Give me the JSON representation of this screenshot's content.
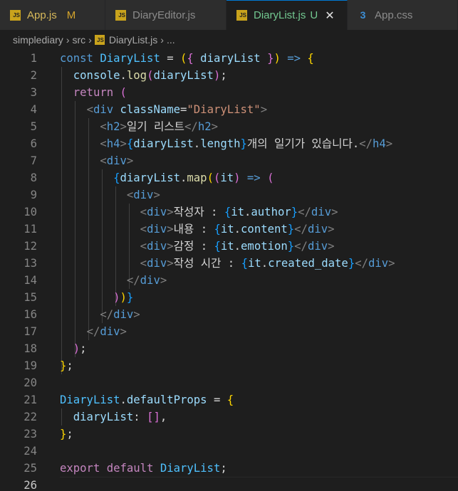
{
  "tabs": [
    {
      "name": "tab-app-js",
      "label": "App.js",
      "badge": "M",
      "icon": "js-icon",
      "width": 148
    },
    {
      "name": "tab-diaryeditor-js",
      "label": "DiaryEditor.js",
      "badge": "",
      "icon": "js-icon",
      "width": 170
    },
    {
      "name": "tab-diarylist-js",
      "label": "DiaryList.js",
      "badge": "U",
      "icon": "js-icon",
      "width": 170,
      "active": true,
      "close": "✕"
    },
    {
      "name": "tab-app-css",
      "label": "App.css",
      "badge": "",
      "icon": "css-icon",
      "width": 155
    }
  ],
  "breadcrumb": [
    "simplediary",
    "src",
    "DiaryList.js",
    "..."
  ],
  "editor": {
    "current_line": 26,
    "lines": [
      [
        [
          "t-kw",
          "const "
        ],
        [
          "t-var",
          "DiaryList"
        ],
        [
          "t-p",
          " = "
        ],
        [
          "b1",
          "("
        ],
        [
          "b2",
          "{"
        ],
        [
          "t-id",
          " diaryList "
        ],
        [
          "b2",
          "}"
        ],
        [
          "b1",
          ")"
        ],
        [
          "t-kw",
          " =>"
        ],
        [
          "t-p",
          " "
        ],
        [
          "b1",
          "{"
        ]
      ],
      [
        [
          "t-p",
          "  "
        ],
        [
          "t-id",
          "console"
        ],
        [
          "t-p",
          "."
        ],
        [
          "t-fn",
          "log"
        ],
        [
          "b2",
          "("
        ],
        [
          "t-id",
          "diaryList"
        ],
        [
          "b2",
          ")"
        ],
        [
          "t-p",
          ";"
        ]
      ],
      [
        [
          "t-p",
          "  "
        ],
        [
          "t-ctl",
          "return"
        ],
        [
          "t-p",
          " "
        ],
        [
          "b2",
          "("
        ]
      ],
      [
        [
          "t-p",
          "    "
        ],
        [
          "t-ang",
          "<"
        ],
        [
          "t-tag",
          "div"
        ],
        [
          "t-p",
          " "
        ],
        [
          "t-attr",
          "className"
        ],
        [
          "t-p",
          "="
        ],
        [
          "t-str",
          "\"DiaryList\""
        ],
        [
          "t-ang",
          ">"
        ]
      ],
      [
        [
          "t-p",
          "      "
        ],
        [
          "t-ang",
          "<"
        ],
        [
          "t-tag",
          "h2"
        ],
        [
          "t-ang",
          ">"
        ],
        [
          "t-txt",
          "일기 리스트"
        ],
        [
          "t-ang",
          "</"
        ],
        [
          "t-tag",
          "h2"
        ],
        [
          "t-ang",
          ">"
        ]
      ],
      [
        [
          "t-p",
          "      "
        ],
        [
          "t-ang",
          "<"
        ],
        [
          "t-tag",
          "h4"
        ],
        [
          "t-ang",
          ">"
        ],
        [
          "b3",
          "{"
        ],
        [
          "t-id",
          "diaryList"
        ],
        [
          "t-p",
          "."
        ],
        [
          "t-id",
          "length"
        ],
        [
          "b3",
          "}"
        ],
        [
          "t-txt",
          "개의 일기가 있습니다."
        ],
        [
          "t-ang",
          "</"
        ],
        [
          "t-tag",
          "h4"
        ],
        [
          "t-ang",
          ">"
        ]
      ],
      [
        [
          "t-p",
          "      "
        ],
        [
          "t-ang",
          "<"
        ],
        [
          "t-tag",
          "div"
        ],
        [
          "t-ang",
          ">"
        ]
      ],
      [
        [
          "t-p",
          "        "
        ],
        [
          "b3",
          "{"
        ],
        [
          "t-id",
          "diaryList"
        ],
        [
          "t-p",
          "."
        ],
        [
          "t-fn",
          "map"
        ],
        [
          "b1",
          "("
        ],
        [
          "b2",
          "("
        ],
        [
          "t-id",
          "it"
        ],
        [
          "b2",
          ")"
        ],
        [
          "t-kw",
          " =>"
        ],
        [
          "t-p",
          " "
        ],
        [
          "b2",
          "("
        ]
      ],
      [
        [
          "t-p",
          "          "
        ],
        [
          "t-ang",
          "<"
        ],
        [
          "t-tag",
          "div"
        ],
        [
          "t-ang",
          ">"
        ]
      ],
      [
        [
          "t-p",
          "            "
        ],
        [
          "t-ang",
          "<"
        ],
        [
          "t-tag",
          "div"
        ],
        [
          "t-ang",
          ">"
        ],
        [
          "t-txt",
          "작성자 : "
        ],
        [
          "b3",
          "{"
        ],
        [
          "t-id",
          "it"
        ],
        [
          "t-p",
          "."
        ],
        [
          "t-id",
          "author"
        ],
        [
          "b3",
          "}"
        ],
        [
          "t-ang",
          "</"
        ],
        [
          "t-tag",
          "div"
        ],
        [
          "t-ang",
          ">"
        ]
      ],
      [
        [
          "t-p",
          "            "
        ],
        [
          "t-ang",
          "<"
        ],
        [
          "t-tag",
          "div"
        ],
        [
          "t-ang",
          ">"
        ],
        [
          "t-txt",
          "내용 : "
        ],
        [
          "b3",
          "{"
        ],
        [
          "t-id",
          "it"
        ],
        [
          "t-p",
          "."
        ],
        [
          "t-id",
          "content"
        ],
        [
          "b3",
          "}"
        ],
        [
          "t-ang",
          "</"
        ],
        [
          "t-tag",
          "div"
        ],
        [
          "t-ang",
          ">"
        ]
      ],
      [
        [
          "t-p",
          "            "
        ],
        [
          "t-ang",
          "<"
        ],
        [
          "t-tag",
          "div"
        ],
        [
          "t-ang",
          ">"
        ],
        [
          "t-txt",
          "감정 : "
        ],
        [
          "b3",
          "{"
        ],
        [
          "t-id",
          "it"
        ],
        [
          "t-p",
          "."
        ],
        [
          "t-id",
          "emotion"
        ],
        [
          "b3",
          "}"
        ],
        [
          "t-ang",
          "</"
        ],
        [
          "t-tag",
          "div"
        ],
        [
          "t-ang",
          ">"
        ]
      ],
      [
        [
          "t-p",
          "            "
        ],
        [
          "t-ang",
          "<"
        ],
        [
          "t-tag",
          "div"
        ],
        [
          "t-ang",
          ">"
        ],
        [
          "t-txt",
          "작성 시간 : "
        ],
        [
          "b3",
          "{"
        ],
        [
          "t-id",
          "it"
        ],
        [
          "t-p",
          "."
        ],
        [
          "t-id",
          "created_date"
        ],
        [
          "b3",
          "}"
        ],
        [
          "t-ang",
          "</"
        ],
        [
          "t-tag",
          "div"
        ],
        [
          "t-ang",
          ">"
        ]
      ],
      [
        [
          "t-p",
          "          "
        ],
        [
          "t-ang",
          "</"
        ],
        [
          "t-tag",
          "div"
        ],
        [
          "t-ang",
          ">"
        ]
      ],
      [
        [
          "t-p",
          "        "
        ],
        [
          "b2",
          ")"
        ],
        [
          "b1",
          ")"
        ],
        [
          "b3",
          "}"
        ]
      ],
      [
        [
          "t-p",
          "      "
        ],
        [
          "t-ang",
          "</"
        ],
        [
          "t-tag",
          "div"
        ],
        [
          "t-ang",
          ">"
        ]
      ],
      [
        [
          "t-p",
          "    "
        ],
        [
          "t-ang",
          "</"
        ],
        [
          "t-tag",
          "div"
        ],
        [
          "t-ang",
          ">"
        ]
      ],
      [
        [
          "t-p",
          "  "
        ],
        [
          "b2",
          ")"
        ],
        [
          "t-p",
          ";"
        ]
      ],
      [
        [
          "b1",
          "}"
        ],
        [
          "t-p",
          ";"
        ]
      ],
      [],
      [
        [
          "t-var",
          "DiaryList"
        ],
        [
          "t-p",
          "."
        ],
        [
          "t-id",
          "defaultProps"
        ],
        [
          "t-p",
          " = "
        ],
        [
          "b1",
          "{"
        ]
      ],
      [
        [
          "t-p",
          "  "
        ],
        [
          "t-id",
          "diaryList"
        ],
        [
          "t-p",
          ": "
        ],
        [
          "b2",
          "[]"
        ],
        [
          "t-p",
          ","
        ]
      ],
      [
        [
          "b1",
          "}"
        ],
        [
          "t-p",
          ";"
        ]
      ],
      [],
      [
        [
          "t-ctl",
          "export"
        ],
        [
          "t-p",
          " "
        ],
        [
          "t-ctl",
          "default"
        ],
        [
          "t-p",
          " "
        ],
        [
          "t-var",
          "DiaryList"
        ],
        [
          "t-p",
          ";"
        ]
      ],
      []
    ]
  }
}
